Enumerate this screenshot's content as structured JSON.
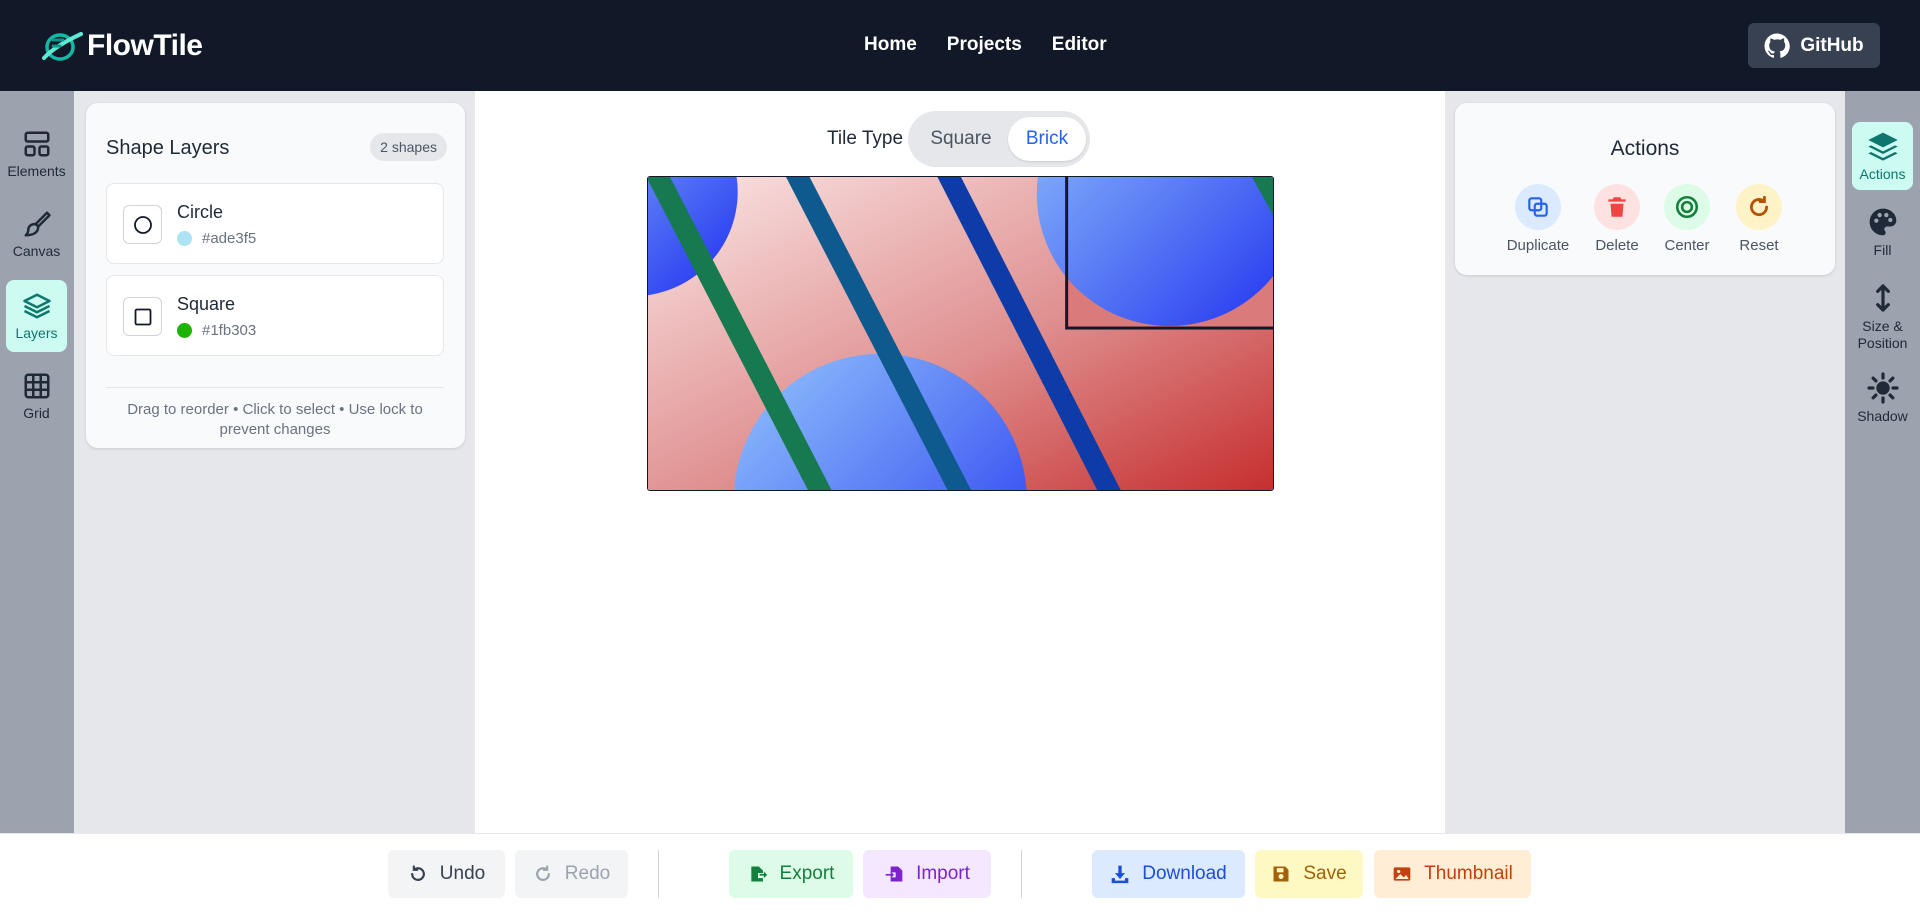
{
  "header": {
    "brand": "FlowTile",
    "nav": [
      "Home",
      "Projects",
      "Editor"
    ],
    "github_label": "GitHub"
  },
  "left_rail": {
    "items": [
      {
        "label": "Elements",
        "icon": "layout-icon"
      },
      {
        "label": "Canvas",
        "icon": "brush-icon"
      },
      {
        "label": "Layers",
        "icon": "layers-icon",
        "active": true
      },
      {
        "label": "Grid",
        "icon": "grid-icon"
      }
    ]
  },
  "layers_panel": {
    "title": "Shape Layers",
    "count": "2 shapes",
    "layers": [
      {
        "name": "Circle",
        "color": "#ade3f5",
        "shape": "circle"
      },
      {
        "name": "Square",
        "color": "#1fb303",
        "shape": "square"
      }
    ],
    "hint": "Drag to reorder • Click to select • Use lock to prevent changes"
  },
  "tile_type": {
    "label": "Tile Type",
    "options": [
      "Square",
      "Brick"
    ],
    "selected": "Brick"
  },
  "actions_panel": {
    "title": "Actions",
    "actions": [
      {
        "label": "Duplicate",
        "icon": "duplicate-icon",
        "color": "#2563eb"
      },
      {
        "label": "Delete",
        "icon": "trash-icon",
        "color": "#ef4444"
      },
      {
        "label": "Center",
        "icon": "target-icon",
        "color": "#15803d"
      },
      {
        "label": "Reset",
        "icon": "reset-icon",
        "color": "#b45309"
      }
    ]
  },
  "right_rail": {
    "items": [
      {
        "label": "Actions",
        "icon": "layers-stack-icon",
        "active": true
      },
      {
        "label": "Fill",
        "icon": "palette-icon"
      },
      {
        "label": "Size & Position",
        "icon": "resize-vertical-icon"
      },
      {
        "label": "Shadow",
        "icon": "sun-icon"
      }
    ]
  },
  "bottom_bar": {
    "undo": "Undo",
    "redo": "Redo",
    "export": "Export",
    "import": "Import",
    "download": "Download",
    "save": "Save",
    "thumbnail": "Thumbnail"
  }
}
